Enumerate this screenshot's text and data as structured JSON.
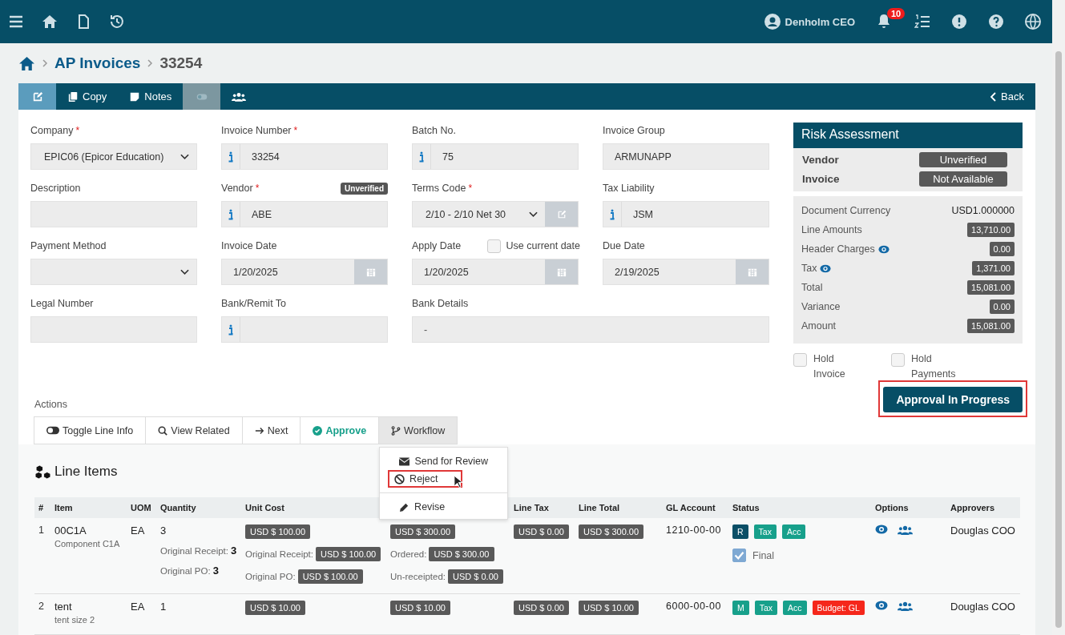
{
  "topbar": {
    "user": "Denholm CEO",
    "notifications": "10"
  },
  "breadcrumb": {
    "section": "AP Invoices",
    "record": "33254"
  },
  "toolbar": {
    "buttons": [
      {
        "kind": "edit",
        "selected": true,
        "disabled": false
      },
      {
        "kind": "copy",
        "label": "Copy",
        "selected": false,
        "disabled": false
      },
      {
        "kind": "notes",
        "label": "Notes",
        "selected": false,
        "disabled": false
      },
      {
        "kind": "toggle",
        "selected": false,
        "disabled": true
      },
      {
        "kind": "people",
        "selected": false,
        "disabled": false
      }
    ],
    "back": "Back"
  },
  "fields": [
    {
      "kind": "select",
      "label": "Company",
      "required_mark": "*",
      "value": "EPIC06 (Epicor Education)"
    },
    {
      "kind": "info",
      "label": "Invoice Number",
      "required_mark": "*",
      "value": "33254"
    },
    {
      "kind": "info",
      "label": "Batch No.",
      "value": "75"
    },
    {
      "kind": "input",
      "label": "Invoice Group",
      "value": "ARMUNAPP"
    },
    {
      "kind": "input",
      "label": "Description"
    },
    {
      "kind": "info",
      "label": "Vendor",
      "required_mark": "*",
      "value": "ABE",
      "badge": "Unverified"
    },
    {
      "kind": "select-edit",
      "label": "Terms Code",
      "required_mark": "*",
      "value": "2/10 - 2/10 Net 30"
    },
    {
      "kind": "info",
      "label": "Tax Liability",
      "value": "JSM"
    },
    {
      "kind": "select",
      "label": "Payment Method"
    },
    {
      "kind": "date",
      "label": "Invoice Date",
      "value": "1/20/2025"
    },
    {
      "kind": "date",
      "label": "Apply Date",
      "value": "1/20/2025",
      "checkbox": {
        "label": "Use current date",
        "checked": false
      }
    },
    {
      "kind": "date",
      "label": "Due Date",
      "value": "2/19/2025"
    },
    {
      "kind": "input",
      "label": "Legal Number"
    },
    {
      "kind": "info",
      "label": "Bank/Remit To"
    },
    {
      "kind": "wide",
      "label": "Bank Details",
      "value": "-"
    }
  ],
  "risk": {
    "title": "Risk Assessment",
    "rows": [
      {
        "label": "Vendor",
        "value": "Unverified"
      },
      {
        "label": "Invoice",
        "value": "Not Available"
      }
    ],
    "summary": [
      {
        "kind": "plain",
        "label": "Document Currency",
        "value": "USD1.000000",
        "eye": false
      },
      {
        "kind": "badge",
        "label": "Line Amounts",
        "value": "13,710.00",
        "eye": false
      },
      {
        "kind": "badge",
        "label": "Header Charges",
        "value": "0.00",
        "eye": true
      },
      {
        "kind": "badge",
        "label": "Tax",
        "value": "1,371.00",
        "eye": true
      },
      {
        "kind": "badge",
        "label": "Total",
        "value": "15,081.00",
        "eye": false
      },
      {
        "kind": "badge",
        "label": "Variance",
        "value": "0.00",
        "eye": false
      },
      {
        "kind": "badge",
        "label": "Amount",
        "value": "15,081.00",
        "eye": false
      }
    ],
    "holds": [
      {
        "label": "Hold Invoice",
        "checked": false
      },
      {
        "label": "Hold Payments",
        "checked": false
      }
    ],
    "status": {
      "label": "Approval In Progress",
      "highlighted": true
    }
  },
  "actions": {
    "label": "Actions",
    "buttons": [
      {
        "kind": "toggle",
        "label": "Toggle Line Info",
        "expanded": false
      },
      {
        "kind": "search",
        "label": "View Related",
        "expanded": false
      },
      {
        "kind": "next",
        "label": "Next",
        "expanded": false
      },
      {
        "kind": "approve",
        "label": "Approve",
        "expanded": false
      },
      {
        "kind": "workflow",
        "label": "Workflow",
        "expanded": true
      }
    ],
    "menu": [
      {
        "kind": "mail",
        "label": "Send for Review",
        "highlighted": false
      },
      {
        "kind": "ban",
        "label": "Reject",
        "highlighted": true
      },
      {
        "kind": "pencil",
        "label": "Revise",
        "highlighted": false
      }
    ]
  },
  "lines": {
    "title": "Line Items",
    "columns": [
      "#",
      "Item",
      "UOM",
      "Quantity",
      "Unit Cost",
      "Line Tax",
      "Line Total",
      "GL Account",
      "Status",
      "Options",
      "Approvers"
    ],
    "rows": [
      {
        "num": "1",
        "item": "00C1A",
        "description": "Component C1A",
        "uom": "EA",
        "quantity": "3",
        "unit_cost": "USD $ 100.00",
        "extended": "USD $ 300.00",
        "line_tax": "USD $ 0.00",
        "line_total": "USD $ 300.00",
        "gl_account": "1210-00-00",
        "statuses": [
          {
            "label": "R",
            "color": "#0b4f67"
          },
          {
            "label": "Tax",
            "color": "#17a08b"
          },
          {
            "label": "Acc",
            "color": "#17a08b"
          }
        ],
        "final": {
          "label": "Final",
          "checked": true
        },
        "approvers": "Douglas COO",
        "qty_details": [
          {
            "label": "Original Receipt:",
            "value": "3"
          },
          {
            "label": "Original PO:",
            "value": "3"
          }
        ],
        "cost_details": [
          {
            "label": "Original Receipt:",
            "value": "USD $ 100.00"
          },
          {
            "label": "Original PO:",
            "value": "USD $ 100.00"
          }
        ],
        "ext_details": [
          {
            "label": "Ordered:",
            "value": "USD $ 300.00"
          },
          {
            "label": "Un-receipted:",
            "value": "USD $ 0.00"
          }
        ]
      },
      {
        "num": "2",
        "item": "tent",
        "description": "tent size 2",
        "uom": "EA",
        "quantity": "1",
        "unit_cost": "USD $ 10.00",
        "extended": "USD $ 10.00",
        "line_tax": "USD $ 0.00",
        "line_total": "USD $ 10.00",
        "gl_account": "6000-00-00",
        "statuses": [
          {
            "label": "M",
            "color": "#17a08b"
          },
          {
            "label": "Tax",
            "color": "#17a08b"
          },
          {
            "label": "Acc",
            "color": "#17a08b"
          },
          {
            "label": "Budget: GL",
            "color": "#f5271b"
          }
        ],
        "approvers": "Douglas COO"
      }
    ]
  }
}
